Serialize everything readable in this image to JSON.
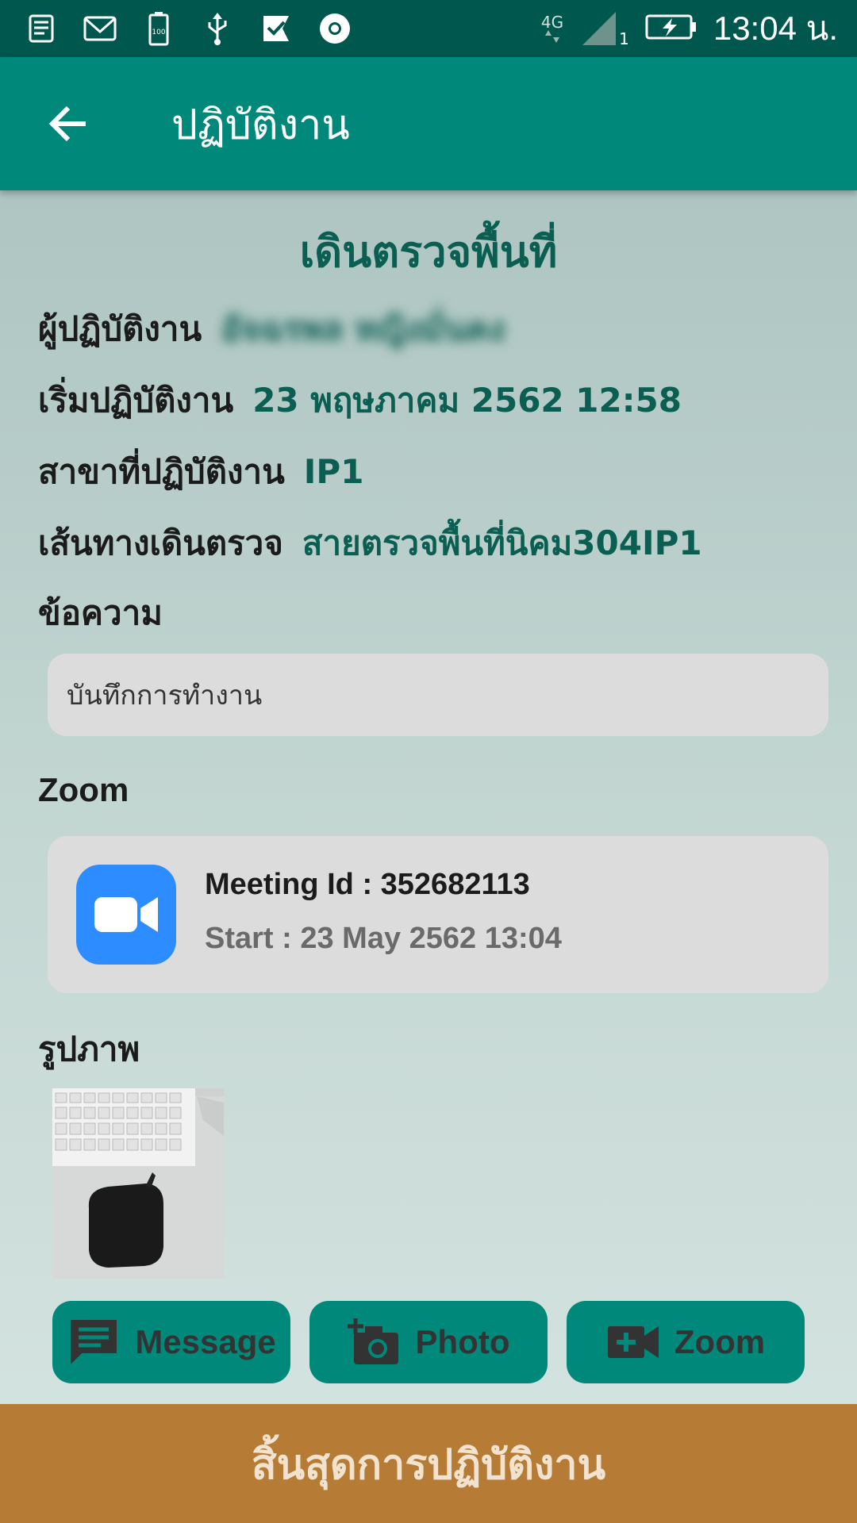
{
  "status_bar": {
    "network": "4G",
    "sim": "1",
    "battery_saver_label": "100",
    "time": "13:04 น."
  },
  "app_bar": {
    "title": "ปฏิบัติงาน"
  },
  "section": {
    "title": "เดินตรวจพื้นที่"
  },
  "details": {
    "operator_label": "ผู้ปฏิบัติงาน",
    "operator_value": "อัจฉรพล หญิงมั่นคง",
    "start_label": "เริ่มปฏิบัติงาน",
    "start_value": "23 พฤษภาคม 2562 12:58",
    "branch_label": "สาขาที่ปฏิบัติงาน",
    "branch_value": "IP1",
    "route_label": "เส้นทางเดินตรวจ",
    "route_value": "สายตรวจพื้นที่นิคม304IP1"
  },
  "message": {
    "label": "ข้อความ",
    "text": "บันทึกการทำงาน"
  },
  "zoom": {
    "label": "Zoom",
    "meeting_id": "Meeting Id : 352682113",
    "start": "Start : 23 May 2562 13:04"
  },
  "photos": {
    "label": "รูปภาพ"
  },
  "actions": {
    "message_label": "Message",
    "photo_label": "Photo",
    "zoom_label": "Zoom"
  },
  "footer": {
    "end_label": "สิ้นสุดการปฏิบัติงาน"
  },
  "colors": {
    "status_bar": "#00574d",
    "app_bar": "#00897b",
    "accent_text": "#0b5e52",
    "end_button": "#b67b34",
    "zoom_blue": "#2d8cff"
  }
}
